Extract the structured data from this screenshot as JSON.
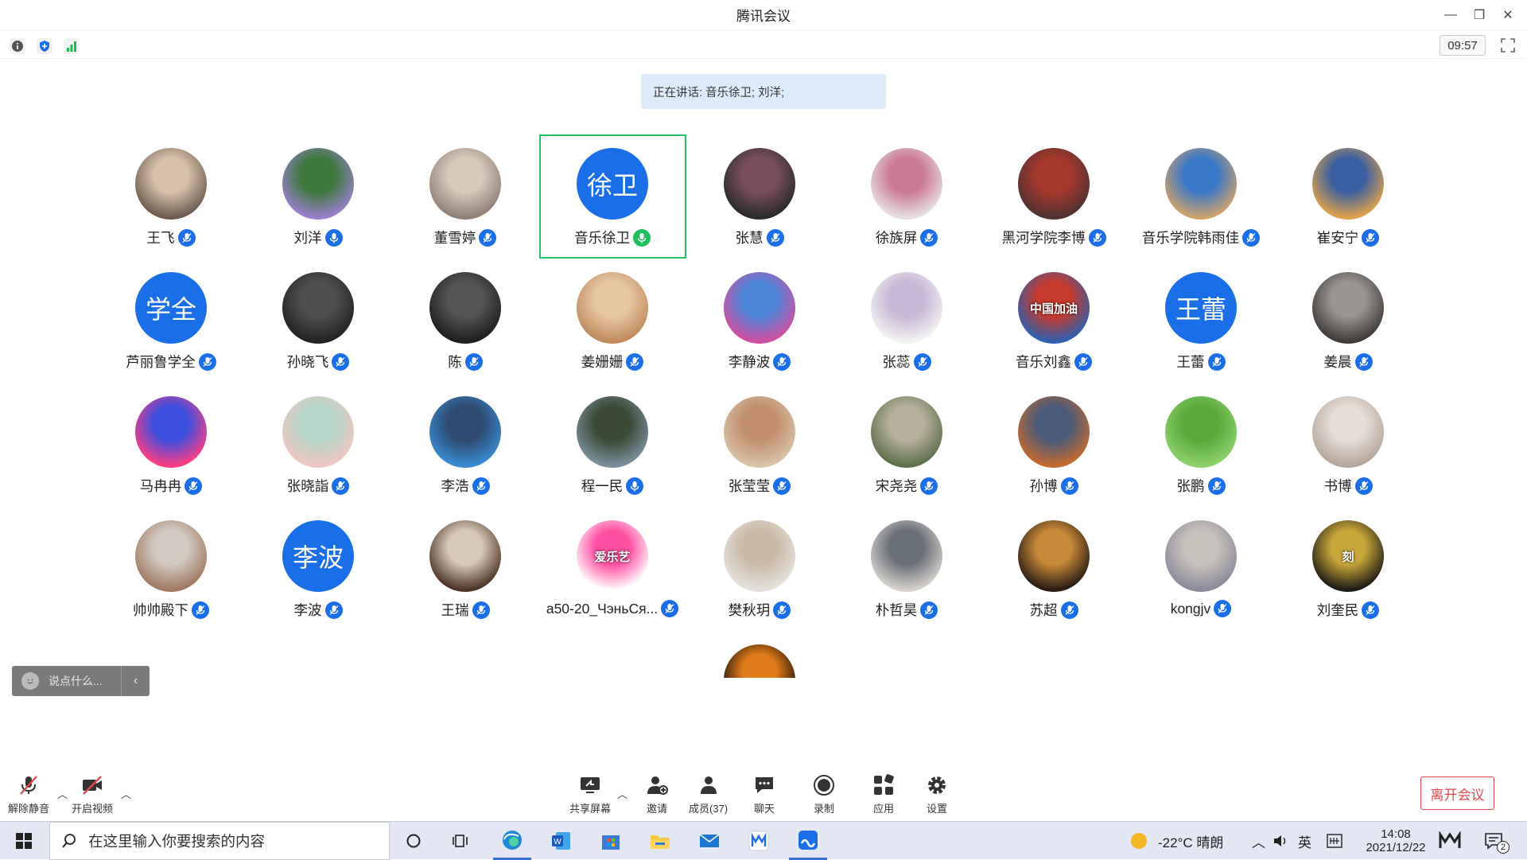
{
  "window": {
    "title": "腾讯会议"
  },
  "header": {
    "time": "09:57"
  },
  "speaking": {
    "text": "正在讲话: 音乐徐卫; 刘洋;"
  },
  "colors": {
    "accent": "#1a6fe8",
    "active_border": "#26c26a",
    "leave": "#e24a4a"
  },
  "participants": [
    {
      "name": "王飞",
      "avatar": "photo"
    },
    {
      "name": "刘洋",
      "avatar": "photo",
      "mic": "speaking-blue"
    },
    {
      "name": "董雪婷",
      "avatar": "photo"
    },
    {
      "name": "音乐徐卫",
      "avatar_text": "徐卫",
      "mic": "speaking-green",
      "active": true
    },
    {
      "name": "张慧",
      "avatar": "photo"
    },
    {
      "name": "徐族屏",
      "avatar": "photo"
    },
    {
      "name": "黑河学院李博",
      "avatar": "photo"
    },
    {
      "name": "音乐学院韩雨佳",
      "avatar": "photo"
    },
    {
      "name": "崔安宁",
      "avatar": "photo"
    },
    {
      "name": "芦丽鲁学全",
      "avatar_text": "学全"
    },
    {
      "name": "孙晓飞",
      "avatar": "photo"
    },
    {
      "name": "陈",
      "avatar": "photo"
    },
    {
      "name": "姜姗姗",
      "avatar": "photo"
    },
    {
      "name": "李静波",
      "avatar": "photo"
    },
    {
      "name": "张蕊",
      "avatar": "photo"
    },
    {
      "name": "音乐刘鑫",
      "avatar": "photo",
      "avatar_caption": "中国加油"
    },
    {
      "name": "王蕾",
      "avatar_text": "王蕾"
    },
    {
      "name": "姜晨",
      "avatar": "photo"
    },
    {
      "name": "马冉冉",
      "avatar": "photo"
    },
    {
      "name": "张晓詣",
      "avatar": "photo"
    },
    {
      "name": "李浩",
      "avatar": "photo"
    },
    {
      "name": "程一民",
      "avatar": "photo",
      "mic": "speaking-blue"
    },
    {
      "name": "张莹莹",
      "avatar": "photo"
    },
    {
      "name": "宋尧尧",
      "avatar": "photo"
    },
    {
      "name": "孙博",
      "avatar": "photo"
    },
    {
      "name": "张鹏",
      "avatar": "photo"
    },
    {
      "name": "书博",
      "avatar": "photo"
    },
    {
      "name": "帅帅殿下",
      "avatar": "photo"
    },
    {
      "name": "李波",
      "avatar_text": "李波"
    },
    {
      "name": "王瑞",
      "avatar": "photo"
    },
    {
      "name": "a50-20_ЧэньСя...",
      "avatar": "photo",
      "avatar_caption": "爱乐艺"
    },
    {
      "name": "樊秋玥",
      "avatar": "photo"
    },
    {
      "name": "朴哲昊",
      "avatar": "photo"
    },
    {
      "name": "苏超",
      "avatar": "photo"
    },
    {
      "name": "kongjv",
      "avatar": "photo"
    },
    {
      "name": "刘奎民",
      "avatar": "photo",
      "avatar_caption": "刻"
    },
    {
      "name": "",
      "avatar": "photo"
    }
  ],
  "chat": {
    "placeholder": "说点什么..."
  },
  "controls": {
    "unmute": "解除静音",
    "video": "开启视频",
    "share": "共享屏幕",
    "invite": "邀请",
    "members": "成员(37)",
    "chat": "聊天",
    "record": "录制",
    "apps": "应用",
    "settings": "设置",
    "leave": "离开会议"
  },
  "taskbar": {
    "search_placeholder": "在这里输入你要搜索的内容",
    "weather": "-22°C  晴朗",
    "ime": "英",
    "time": "14:08",
    "date": "2021/12/22",
    "notifications": "2"
  }
}
